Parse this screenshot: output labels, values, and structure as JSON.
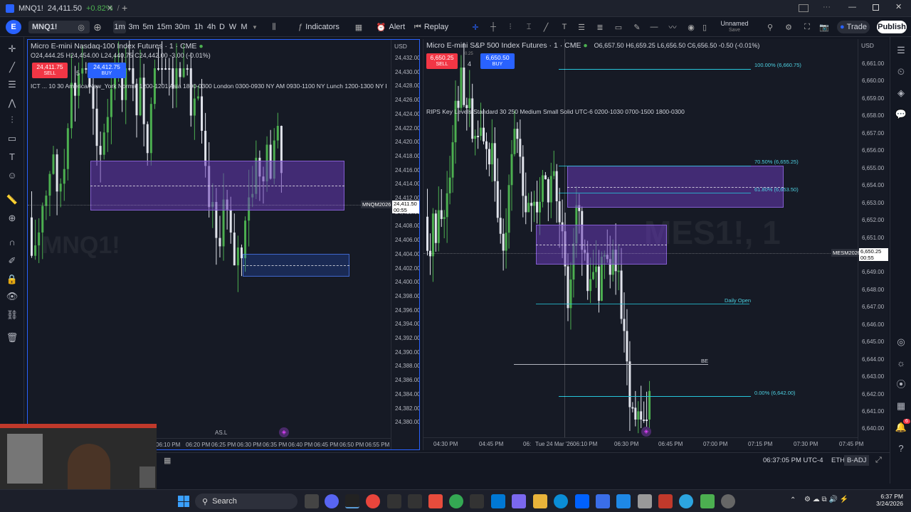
{
  "window": {
    "tab_title": "MNQ1!",
    "tab_price": "24,411.50",
    "tab_change": "+0.82%",
    "tab_separator": "/",
    "new_tab": "+",
    "close_tab": "✕"
  },
  "toolbar": {
    "symbol": "MNQ1!",
    "intervals": [
      "1m",
      "3m",
      "5m",
      "15m",
      "30m",
      "1h",
      "4h",
      "D",
      "W",
      "M"
    ],
    "indicators_label": "Indicators",
    "alert_label": "Alert",
    "replay_label": "Replay",
    "layout_name": "Unnamed",
    "layout_sub": "Save",
    "trade_label": "Trade",
    "publish_label": "Publish"
  },
  "left_chart": {
    "title": "Micro E-mini Nasdaq-100 Index Futures · 1 · CME",
    "ohlc": "O24,444.25 H24,454.00 L24,440.75 C24,442.00 -3.00 (-0.01%)",
    "sell_price": "24,411.75",
    "sell_label": "SELL",
    "spread": "5",
    "buy_price": "24,412.75",
    "buy_label": "BUY",
    "indicator_text": "ICT ... 10 30 America/New_York Normal 1200-1201 Asia 1800-0300 London 0300-0930 NY AM 0930-1100 NY Lunch 1200-1300 NY P",
    "currency": "USD",
    "y_ticks": [
      "24,432.00",
      "24,430.00",
      "24,428.00",
      "24,426.00",
      "24,424.00",
      "24,422.00",
      "24,420.00",
      "24,418.00",
      "24,416.00",
      "24,414.00",
      "24,412.00",
      "24,410.00",
      "24,408.00",
      "24,406.00",
      "24,404.00",
      "24,402.00",
      "24,400.00",
      "24,398.00",
      "24,396.00",
      "24,394.00",
      "24,392.00",
      "24,390.00",
      "24,388.00",
      "24,386.00",
      "24,384.00",
      "24,382.00",
      "24,380.00"
    ],
    "x_ticks": [
      "06:10 PM",
      "06:20 PM",
      "06:25 PM",
      "06:30 PM",
      "06:35 PM",
      "06:40 PM",
      "06:45 PM",
      "06:50 PM",
      "06:55 PM"
    ],
    "symbol_badge": "MNQM2026",
    "last_price": "24,411.50",
    "countdown": "00:55",
    "as_label": "AS.L",
    "watermark": "MNQ1!"
  },
  "right_chart": {
    "title": "Micro E-mini S&P 500 Index Futures · 1 · CME",
    "ohlc": "O6,657.50 H6,659.25 L6,656.50 C6,656.50 -0.50 (-0.01%)",
    "sell_price": "6,650.25",
    "sell_label": "SELL",
    "spread": "4",
    "spread_top": "0.25",
    "buy_price": "6,650.50",
    "buy_label": "BUY",
    "indicator_text": "RIPS Key Levels Standard 30 250 Medium Small Solid UTC-6 0200-1030 0700-1500 1800-0300",
    "currency": "USD",
    "y_ticks": [
      "6,661.00",
      "6,660.00",
      "6,659.00",
      "6,658.00",
      "6,657.00",
      "6,656.00",
      "6,655.00",
      "6,654.00",
      "6,653.00",
      "6,652.00",
      "6,651.00",
      "6,650.00",
      "6,649.00",
      "6,648.00",
      "6,647.00",
      "6,646.00",
      "6,645.00",
      "6,644.00",
      "6,643.00",
      "6,642.00",
      "6,641.00",
      "6,640.00"
    ],
    "x_ticks": [
      "04:30 PM",
      "04:45 PM",
      "06:",
      "Tue 24 Mar '26",
      "06:10 PM",
      "06:30 PM",
      "06:45 PM",
      "07:00 PM",
      "07:15 PM",
      "07:30 PM",
      "07:45 PM"
    ],
    "fib_100": "100.00% (6,660.75)",
    "fib_705": "70.50% (6,655.25)",
    "fib_618": "61.80% (6,653.50)",
    "fib_0": "0.00% (6,642.00)",
    "daily_open": "Daily Open",
    "be_label": "BE",
    "symbol_badge": "MESM2026",
    "last_price": "6,650.25",
    "countdown": "00:55",
    "watermark": "MES1!, 1"
  },
  "status": {
    "time": "06:37:05 PM UTC-4",
    "session": "ETH",
    "adj": "B-ADJ"
  },
  "taskbar": {
    "search_label": "Search",
    "clock_time": "6:37 PM",
    "clock_date": "3/24/2026",
    "notif_count": "6"
  },
  "colors": {
    "up": "#4caf50",
    "down": "#e0e3eb",
    "sell": "#f23645",
    "buy": "#2962ff",
    "zone": "#673ab7",
    "fib": "#26c6da"
  }
}
